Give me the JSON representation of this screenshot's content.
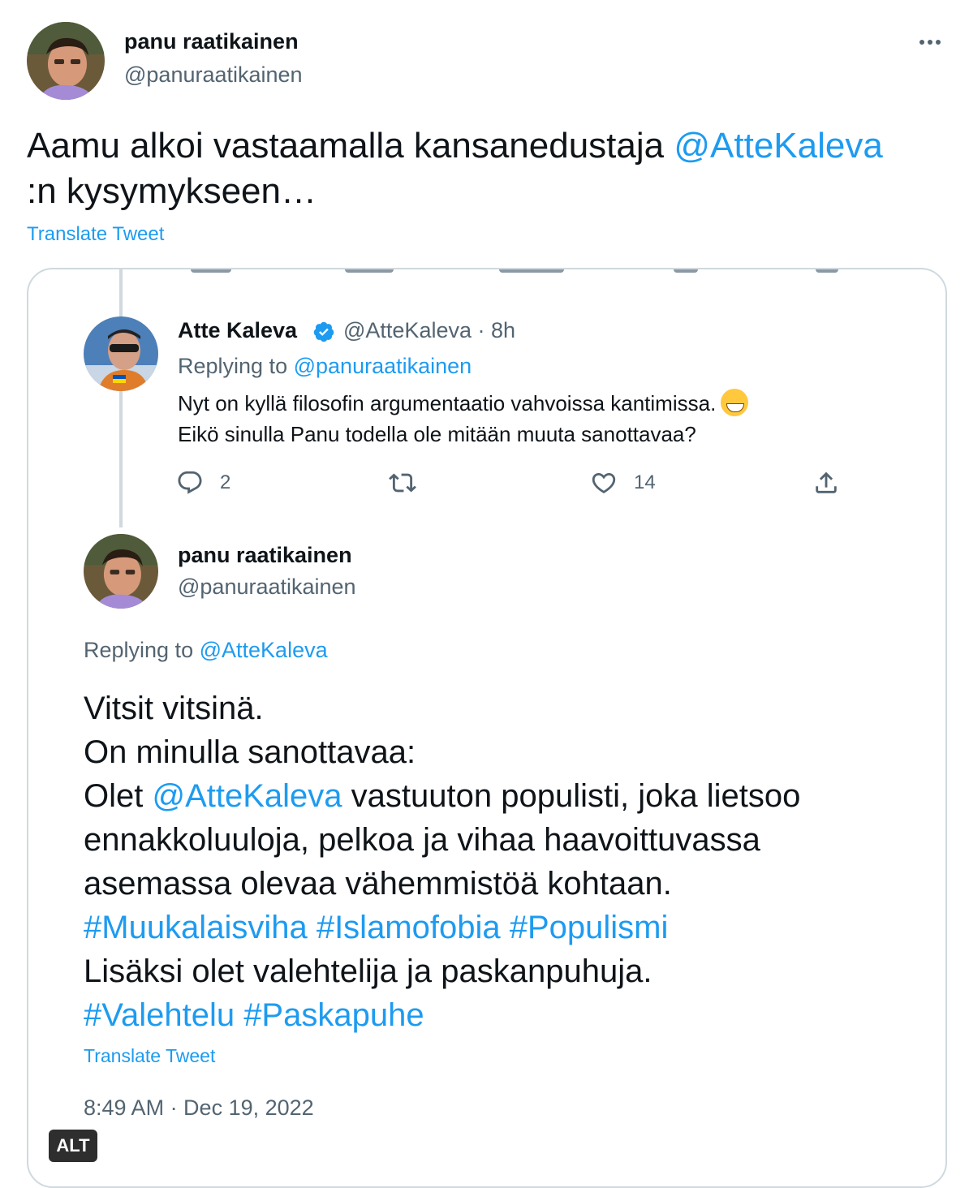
{
  "author": {
    "name": "panu raatikainen",
    "handle": "@panuraatikainen"
  },
  "tweet": {
    "text_before": "Aamu alkoi vastaamalla kansanedustaja ",
    "mention": "@AtteKaleva",
    "text_after": ":n kysymykseen…",
    "translate_label": "Translate Tweet"
  },
  "embedded": {
    "reply1": {
      "name": "Atte Kaleva",
      "handle": "@AtteKaleva",
      "time": "8h",
      "replying_to_label": "Replying to",
      "replying_to_handle": "@panuraatikainen",
      "line1": "Nyt on kyllä filosofin argumentaatio vahvoissa kantimissa.",
      "line2": "Eikö sinulla Panu todella ole mitään muuta sanottavaa?",
      "reply_count": "2",
      "like_count": "14"
    },
    "reply2": {
      "name": "panu raatikainen",
      "handle": "@panuraatikainen",
      "replying_to_label": "Replying to",
      "replying_to_handle": "@AtteKaleva",
      "line1": "Vitsit vitsinä.",
      "line2": "On minulla sanottavaa:",
      "line3_pre": "Olet ",
      "line3_mention": "@AtteKaleva",
      "line3_post": " vastuuton populisti, joka lietsoo",
      "line4": "ennakkoluuloja, pelkoa ja vihaa haavoittuvassa",
      "line5": "asemassa olevaa vähemmistöä kohtaan.",
      "hashtags1": "#Muukalaisviha #Islamofobia #Populismi",
      "line7": "Lisäksi olet valehtelija ja paskanpuhuja.",
      "hashtags2": "#Valehtelu #Paskapuhe",
      "translate_label": "Translate Tweet",
      "timestamp": "8:49 AM · Dec 19, 2022"
    }
  },
  "alt_badge": "ALT",
  "colors": {
    "link": "#1d9bf0",
    "muted": "#536471",
    "text": "#0f1419",
    "border": "#cfd9de"
  }
}
